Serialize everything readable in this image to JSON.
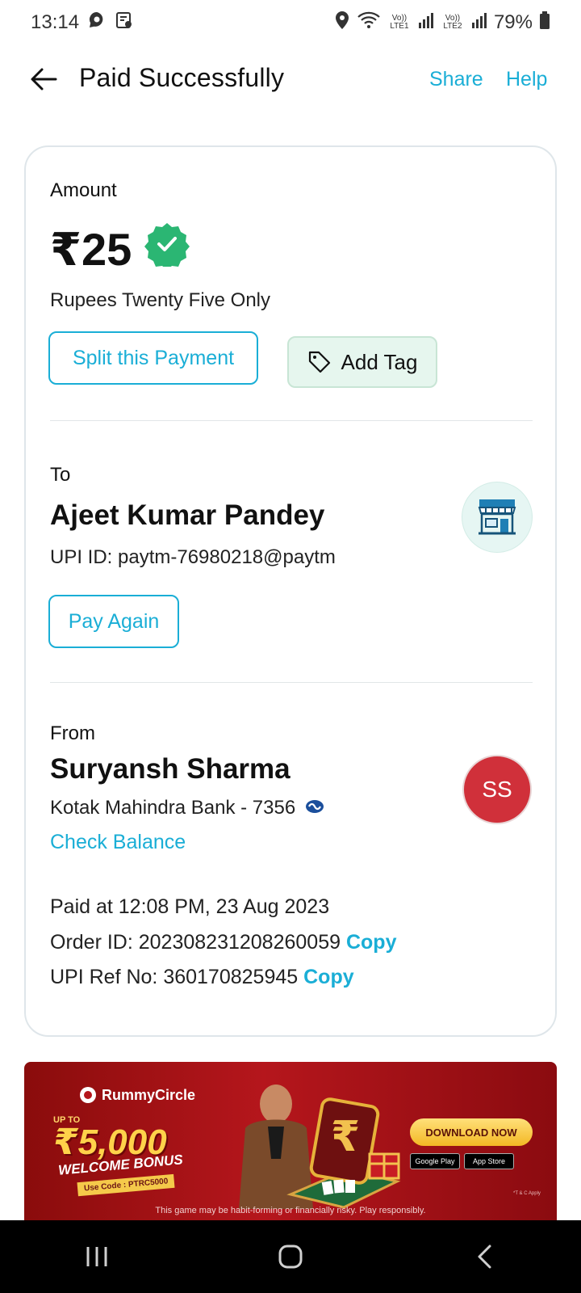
{
  "status_bar": {
    "time": "13:14",
    "battery": "79%",
    "sim1": "Vo)) LTE1",
    "sim2": "Vo)) LTE2"
  },
  "header": {
    "title": "Paid Successfully",
    "share_label": "Share",
    "help_label": "Help"
  },
  "payment": {
    "amount_label": "Amount",
    "amount": "₹25",
    "amount_words": "Rupees Twenty Five Only",
    "split_label": "Split this Payment",
    "tag_label": "Add Tag"
  },
  "recipient": {
    "label": "To",
    "name": "Ajeet Kumar Pandey",
    "upi_id": "UPI ID: paytm-76980218@paytm",
    "pay_again_label": "Pay Again"
  },
  "sender": {
    "label": "From",
    "name": "Suryansh Sharma",
    "bank": "Kotak Mahindra Bank - 7356",
    "initials": "SS",
    "check_balance_label": "Check Balance"
  },
  "details": {
    "paid_at": "Paid at 12:08 PM, 23 Aug 2023",
    "order_id": "Order ID: 202308231208260059",
    "upi_ref": "UPI Ref No: 360170825945",
    "copy_label": "Copy"
  },
  "banner": {
    "brand": "RummyCircle",
    "up_to": "UP TO",
    "bonus_amount": "₹5,000",
    "welcome": "WELCOME BONUS",
    "use_code": "Use Code : PTRC5000",
    "download_label": "DOWNLOAD NOW",
    "google_play": "Google Play",
    "app_store": "App Store",
    "tnc": "*T & C Apply",
    "disclaimer": "This game may be habit-forming or financially risky. Play responsibly."
  },
  "colors": {
    "accent": "#1aaed6",
    "success": "#2bb673",
    "avatar": "#d0303a"
  }
}
